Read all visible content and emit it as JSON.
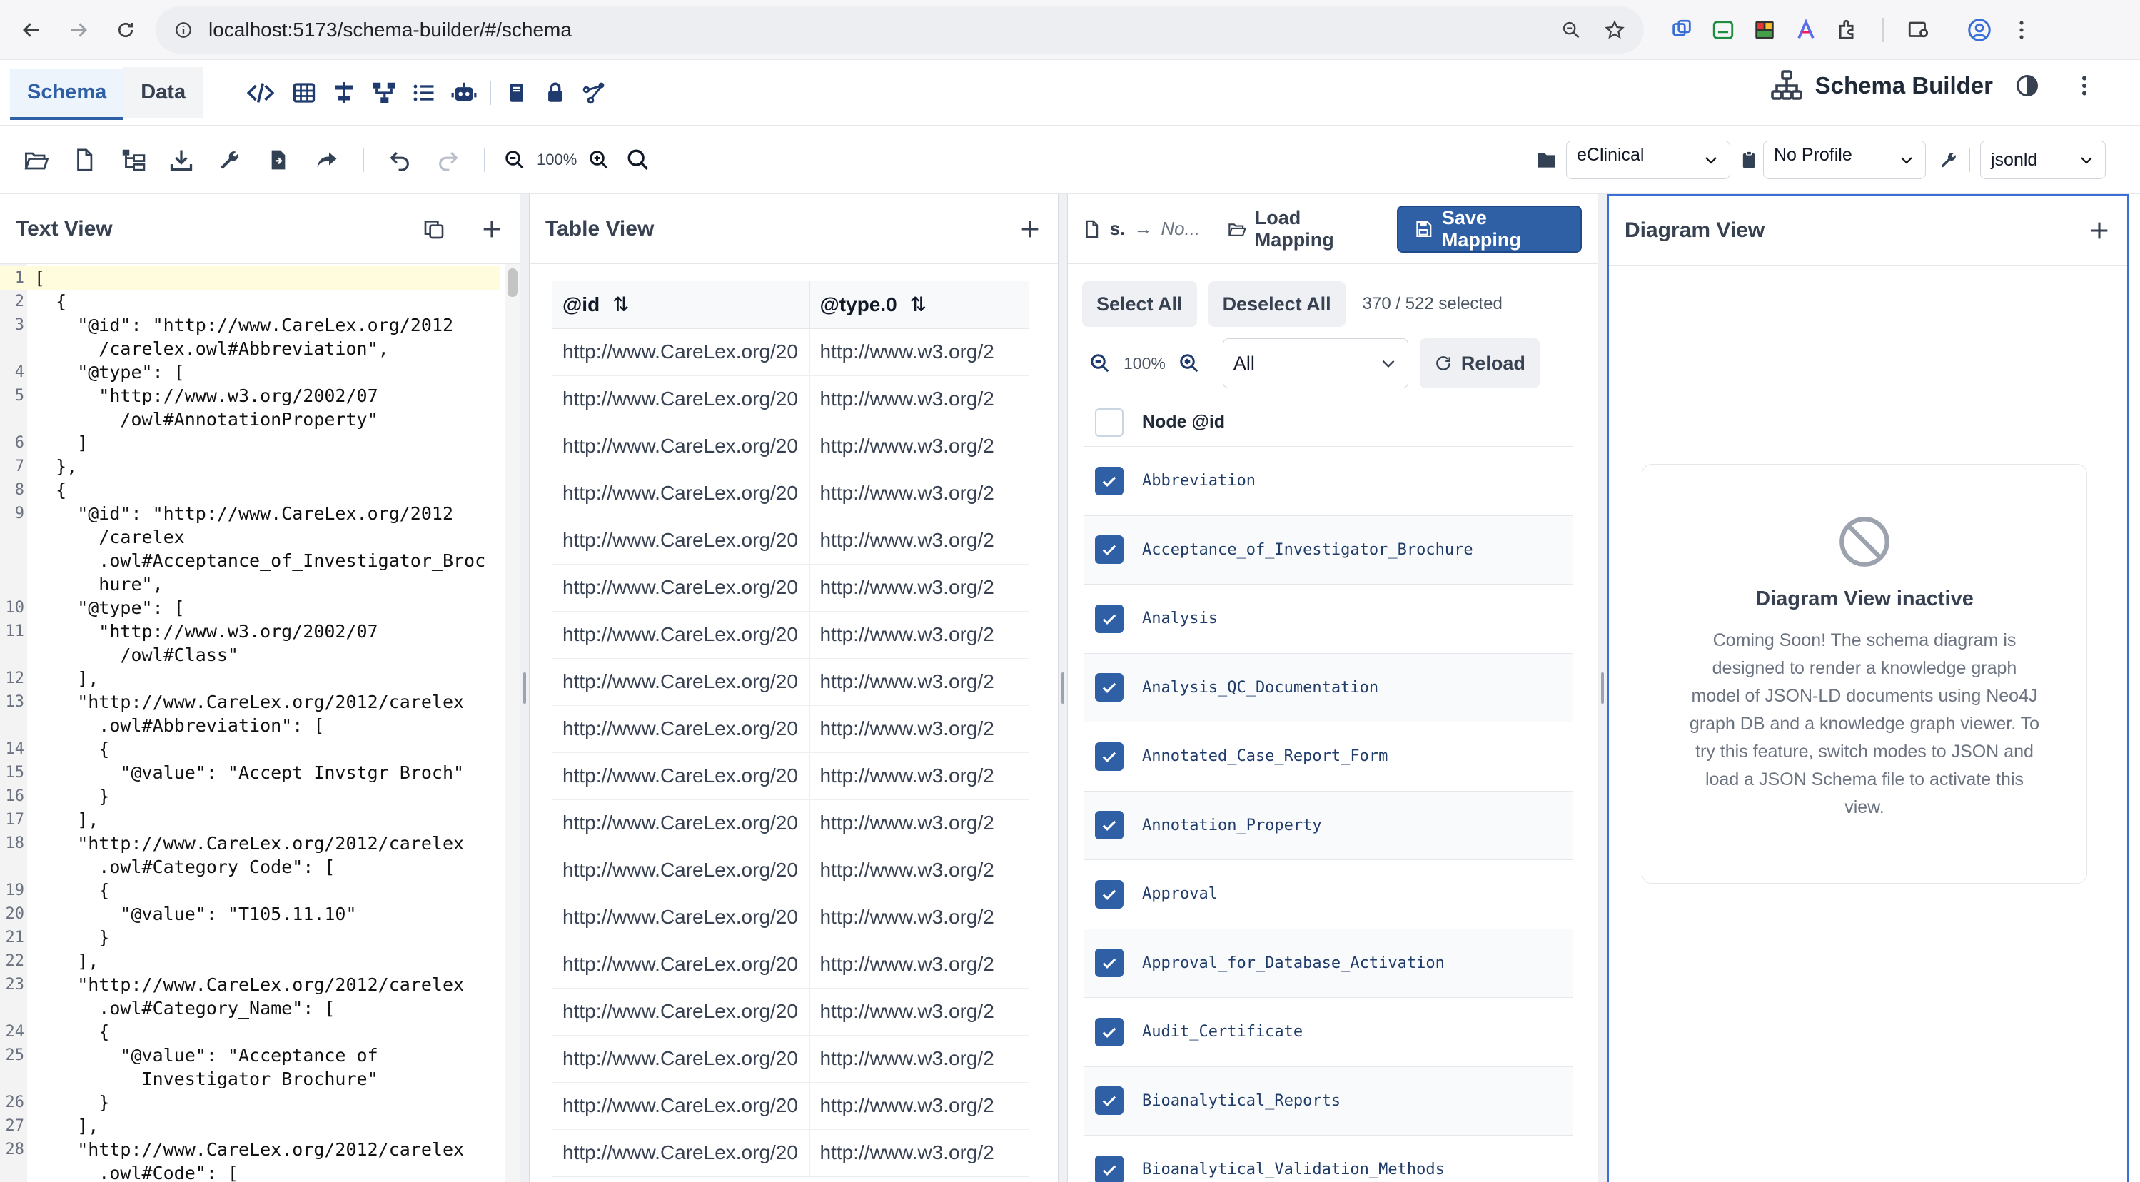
{
  "browser": {
    "url": "localhost:5173/schema-builder/#/schema"
  },
  "app": {
    "title": "Schema Builder",
    "tabs": [
      {
        "label": "Schema",
        "active": true
      },
      {
        "label": "Data",
        "active": false
      }
    ],
    "header_icons": [
      "code-icon",
      "table-icon",
      "split-icon",
      "tree-icon",
      "list-icon",
      "robot-icon",
      "book-icon",
      "lock-icon",
      "graph-icon"
    ]
  },
  "toolbar": {
    "zoom_level": "100%",
    "project_select": "eClinical",
    "profile_select": "No Profile",
    "format_select": "jsonld"
  },
  "text_view": {
    "title": "Text View",
    "lines": [
      {
        "n": "1",
        "text": "["
      },
      {
        "n": "2",
        "text": "  {"
      },
      {
        "n": "3",
        "text": "    \"@id\": \"http://www.CareLex.org/2012"
      },
      {
        "n": "",
        "text": "      /carelex.owl#Abbreviation\","
      },
      {
        "n": "4",
        "text": "    \"@type\": ["
      },
      {
        "n": "5",
        "text": "      \"http://www.w3.org/2002/07"
      },
      {
        "n": "",
        "text": "        /owl#AnnotationProperty\""
      },
      {
        "n": "6",
        "text": "    ]"
      },
      {
        "n": "7",
        "text": "  },"
      },
      {
        "n": "8",
        "text": "  {"
      },
      {
        "n": "9",
        "text": "    \"@id\": \"http://www.CareLex.org/2012"
      },
      {
        "n": "",
        "text": "      /carelex"
      },
      {
        "n": "",
        "text": "      .owl#Acceptance_of_Investigator_Broc"
      },
      {
        "n": "",
        "text": "      hure\","
      },
      {
        "n": "10",
        "text": "    \"@type\": ["
      },
      {
        "n": "11",
        "text": "      \"http://www.w3.org/2002/07"
      },
      {
        "n": "",
        "text": "        /owl#Class\""
      },
      {
        "n": "12",
        "text": "    ],"
      },
      {
        "n": "13",
        "text": "    \"http://www.CareLex.org/2012/carelex"
      },
      {
        "n": "",
        "text": "      .owl#Abbreviation\": ["
      },
      {
        "n": "14",
        "text": "      {"
      },
      {
        "n": "15",
        "text": "        \"@value\": \"Accept Invstgr Broch\""
      },
      {
        "n": "16",
        "text": "      }"
      },
      {
        "n": "17",
        "text": "    ],"
      },
      {
        "n": "18",
        "text": "    \"http://www.CareLex.org/2012/carelex"
      },
      {
        "n": "",
        "text": "      .owl#Category_Code\": ["
      },
      {
        "n": "19",
        "text": "      {"
      },
      {
        "n": "20",
        "text": "        \"@value\": \"T105.11.10\""
      },
      {
        "n": "21",
        "text": "      }"
      },
      {
        "n": "22",
        "text": "    ],"
      },
      {
        "n": "23",
        "text": "    \"http://www.CareLex.org/2012/carelex"
      },
      {
        "n": "",
        "text": "      .owl#Category_Name\": ["
      },
      {
        "n": "24",
        "text": "      {"
      },
      {
        "n": "25",
        "text": "        \"@value\": \"Acceptance of"
      },
      {
        "n": "",
        "text": "          Investigator Brochure\""
      },
      {
        "n": "26",
        "text": "      }"
      },
      {
        "n": "27",
        "text": "    ],"
      },
      {
        "n": "28",
        "text": "    \"http://www.CareLex.org/2012/carelex"
      },
      {
        "n": "",
        "text": "      .owl#Code\": ["
      }
    ]
  },
  "table_view": {
    "title": "Table View",
    "columns": [
      "@id",
      "@type.0"
    ],
    "rows": [
      [
        "http://www.CareLex.org/20",
        "http://www.w3.org/2"
      ],
      [
        "http://www.CareLex.org/20",
        "http://www.w3.org/2"
      ],
      [
        "http://www.CareLex.org/20",
        "http://www.w3.org/2"
      ],
      [
        "http://www.CareLex.org/20",
        "http://www.w3.org/2"
      ],
      [
        "http://www.CareLex.org/20",
        "http://www.w3.org/2"
      ],
      [
        "http://www.CareLex.org/20",
        "http://www.w3.org/2"
      ],
      [
        "http://www.CareLex.org/20",
        "http://www.w3.org/2"
      ],
      [
        "http://www.CareLex.org/20",
        "http://www.w3.org/2"
      ],
      [
        "http://www.CareLex.org/20",
        "http://www.w3.org/2"
      ],
      [
        "http://www.CareLex.org/20",
        "http://www.w3.org/2"
      ],
      [
        "http://www.CareLex.org/20",
        "http://www.w3.org/2"
      ],
      [
        "http://www.CareLex.org/20",
        "http://www.w3.org/2"
      ],
      [
        "http://www.CareLex.org/20",
        "http://www.w3.org/2"
      ],
      [
        "http://www.CareLex.org/20",
        "http://www.w3.org/2"
      ],
      [
        "http://www.CareLex.org/20",
        "http://www.w3.org/2"
      ],
      [
        "http://www.CareLex.org/20",
        "http://www.w3.org/2"
      ],
      [
        "http://www.CareLex.org/20",
        "http://www.w3.org/2"
      ],
      [
        "http://www.CareLex.org/20",
        "http://www.w3.org/2"
      ]
    ]
  },
  "mapping": {
    "breadcrumb_file": "s.",
    "breadcrumb_arrow": "→",
    "breadcrumb_profile": "No...",
    "load_label": "Load Mapping",
    "save_label": "Save Mapping",
    "select_all": "Select All",
    "deselect_all": "Deselect All",
    "selected_count": "370 / 522 selected",
    "zoom": "100%",
    "filter": "All",
    "reload": "Reload",
    "column_header": "Node @id",
    "nodes": [
      {
        "label": "Abbreviation",
        "checked": true
      },
      {
        "label": "Acceptance_of_Investigator_Brochure",
        "checked": true
      },
      {
        "label": "Analysis",
        "checked": true
      },
      {
        "label": "Analysis_QC_Documentation",
        "checked": true
      },
      {
        "label": "Annotated_Case_Report_Form",
        "checked": true
      },
      {
        "label": "Annotation_Property",
        "checked": true
      },
      {
        "label": "Approval",
        "checked": true
      },
      {
        "label": "Approval_for_Database_Activation",
        "checked": true
      },
      {
        "label": "Audit_Certificate",
        "checked": true
      },
      {
        "label": "Bioanalytical_Reports",
        "checked": true
      },
      {
        "label": "Bioanalytical_Validation_Methods",
        "checked": true
      }
    ]
  },
  "diagram_view": {
    "title": "Diagram View",
    "inactive_title": "Diagram View inactive",
    "message_lines": [
      "Coming Soon! The schema diagram is",
      "designed to render a knowledge graph",
      "model of JSON-LD documents using Neo4J",
      "graph DB and a knowledge graph viewer. To",
      "try this feature, switch modes to JSON and",
      "load a JSON Schema file to activate this",
      "view."
    ]
  },
  "colors": {
    "accent": "#2f5fa5",
    "header_text": "#374151"
  }
}
